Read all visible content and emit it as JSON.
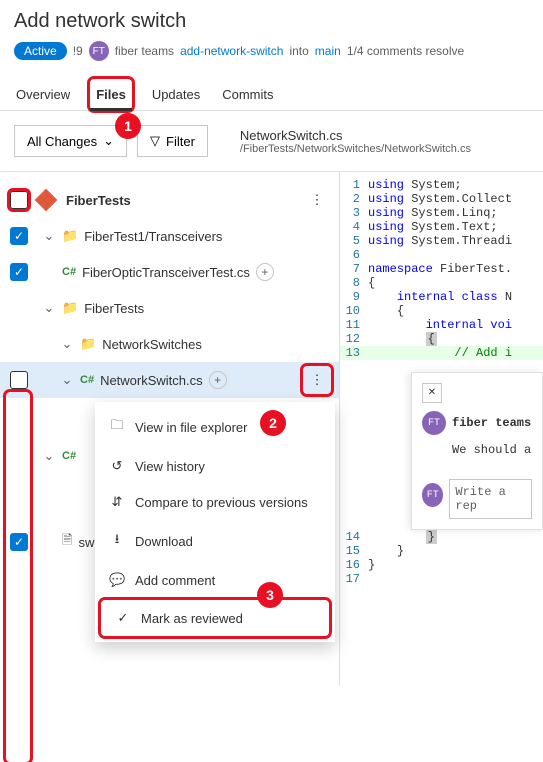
{
  "header": {
    "title": "Add network switch",
    "status": "Active",
    "id": "!9",
    "avatar": "FT",
    "team": "fiber teams",
    "branch": "add-network-switch",
    "into": "into",
    "target": "main",
    "comments": "1/4 comments resolve"
  },
  "tabs": {
    "overview": "Overview",
    "files": "Files",
    "updates": "Updates",
    "commits": "Commits"
  },
  "toolbar": {
    "all_changes": "All Changes",
    "filter": "Filter",
    "filename": "NetworkSwitch.cs",
    "filepath": "/FiberTests/NetworkSwitches/NetworkSwitch.cs"
  },
  "tree": {
    "root": "FiberTests",
    "n1": "FiberTest1/Transceivers",
    "f1": "FiberOpticTransceiverTest.cs",
    "n2": "FiberTests",
    "n3": "NetworkSwitches",
    "f2": "NetworkSwitch.cs",
    "f3": "C#",
    "f4": "sw"
  },
  "menu": {
    "m1": "View in file explorer",
    "m2": "View history",
    "m3": "Compare to previous versions",
    "m4": "Download",
    "m5": "Add comment",
    "m6": "Mark as reviewed"
  },
  "code": {
    "l1a": "using",
    "l1b": "System;",
    "l2a": "using",
    "l2b": "System.Collect",
    "l3a": "using",
    "l3b": "System.Linq;",
    "l4a": "using",
    "l4b": "System.Text;",
    "l5a": "using",
    "l5b": "System.Threadi",
    "l7a": "namespace",
    "l7b": "FiberTest.",
    "l8": "{",
    "l9a": "internal",
    "l9b": "class",
    "l9c": "N",
    "l10": "{",
    "l11a": "internal",
    "l11b": "voi",
    "l12": "{",
    "l13": "// Add i",
    "l14": "}",
    "l15": "}",
    "l16": "}",
    "l17": "}"
  },
  "comments": {
    "close": "✕",
    "author": "fiber teams",
    "text": "We should a",
    "reply": "Write a rep"
  },
  "annotations": {
    "n1": "1",
    "n2": "2",
    "n3": "3"
  }
}
